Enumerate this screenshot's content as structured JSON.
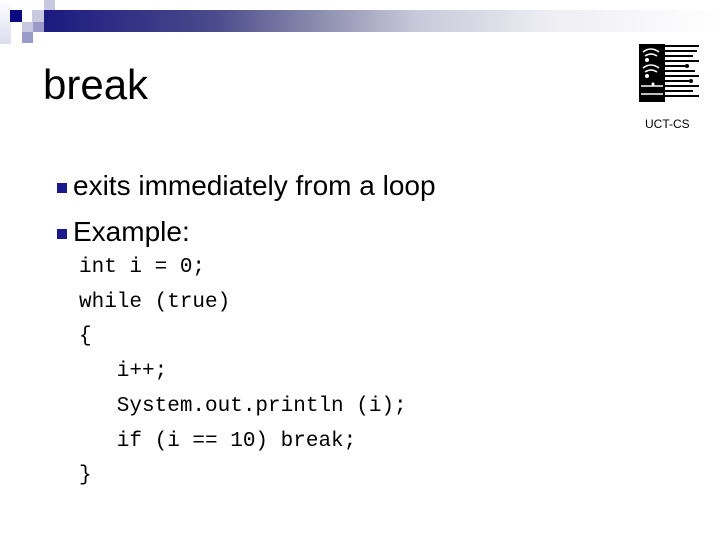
{
  "slide": {
    "title": "break",
    "logo_caption": "UCT-CS",
    "logo_icon": "uct-cs-circuit-logo",
    "bullets": [
      {
        "text": "exits immediately from a loop"
      },
      {
        "text": "Example:"
      }
    ],
    "code_lines": [
      "int i = 0;",
      "while (true)",
      "{",
      "   i++;",
      "   System.out.println (i);",
      "   if (i == 10) break;",
      "}"
    ]
  },
  "colors": {
    "accent_navy": "#1a1a80",
    "bullet": "#1a1a8c"
  }
}
